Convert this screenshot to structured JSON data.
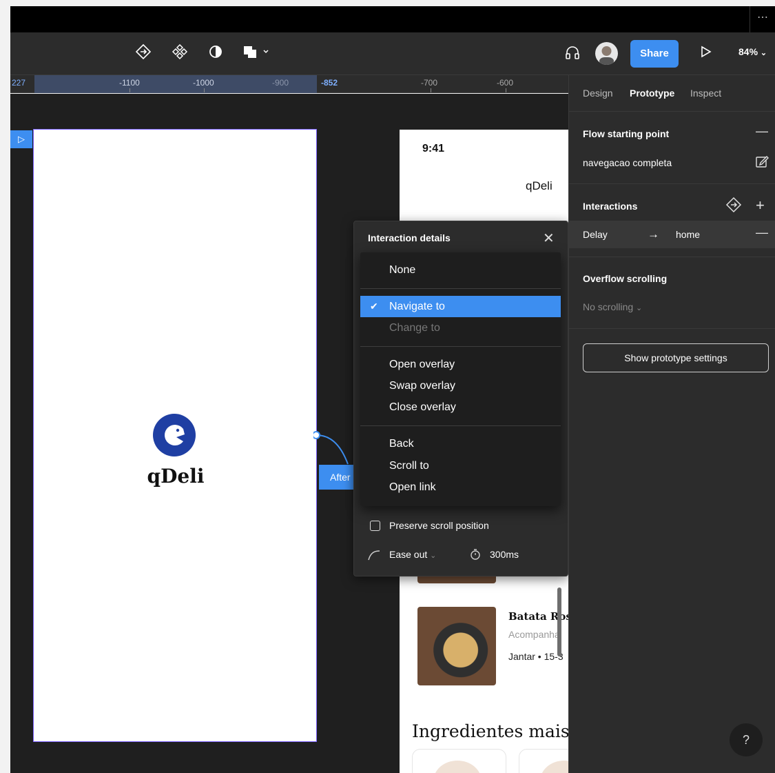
{
  "toolbar": {
    "icons": [
      "prototype-link-icon",
      "component-icon",
      "contrast-icon",
      "shape-icon"
    ],
    "share_label": "Share",
    "zoom": "84%"
  },
  "ruler": {
    "ticks": [
      "227",
      "-1100",
      "-1000",
      "-900",
      "-852",
      "-700",
      "-600"
    ]
  },
  "canvas": {
    "splash_brand": "qDeli",
    "phone_time": "9:41",
    "phone_brand": "qDeli",
    "recipe_title": "Batata Ros",
    "recipe_category": "Acompanha",
    "recipe_meta": "Jantar • 15-3",
    "section_title": "Ingredientes mais",
    "connector_tag": "After"
  },
  "dialog": {
    "title": "Interaction details",
    "menu_items": [
      {
        "label": "None",
        "selected": false,
        "disabled": false
      },
      {
        "label": "Navigate to",
        "selected": true,
        "disabled": false
      },
      {
        "label": "Change to",
        "selected": false,
        "disabled": true
      },
      {
        "label": "Open overlay",
        "selected": false,
        "disabled": false
      },
      {
        "label": "Swap overlay",
        "selected": false,
        "disabled": false
      },
      {
        "label": "Close overlay",
        "selected": false,
        "disabled": false
      },
      {
        "label": "Back",
        "selected": false,
        "disabled": false
      },
      {
        "label": "Scroll to",
        "selected": false,
        "disabled": false
      },
      {
        "label": "Open link",
        "selected": false,
        "disabled": false
      }
    ],
    "preserve_scroll_label": "Preserve scroll position",
    "easing_label": "Ease out",
    "duration": "300ms"
  },
  "panel": {
    "tabs": [
      "Design",
      "Prototype",
      "Inspect"
    ],
    "active_tab": "Prototype",
    "flow_heading": "Flow starting point",
    "flow_name": "navegacao completa",
    "interactions_heading": "Interactions",
    "interaction_trigger": "Delay",
    "interaction_target": "home",
    "overflow_heading": "Overflow scrolling",
    "overflow_value": "No scrolling",
    "settings_button": "Show prototype settings",
    "help_label": "?"
  },
  "colors": {
    "accent": "#3d8ef0",
    "panel_bg": "#2c2c2c",
    "canvas_bg": "#1f1f1f",
    "frame_outline": "#7b61ff",
    "brand_blue": "#1f3fa3"
  }
}
